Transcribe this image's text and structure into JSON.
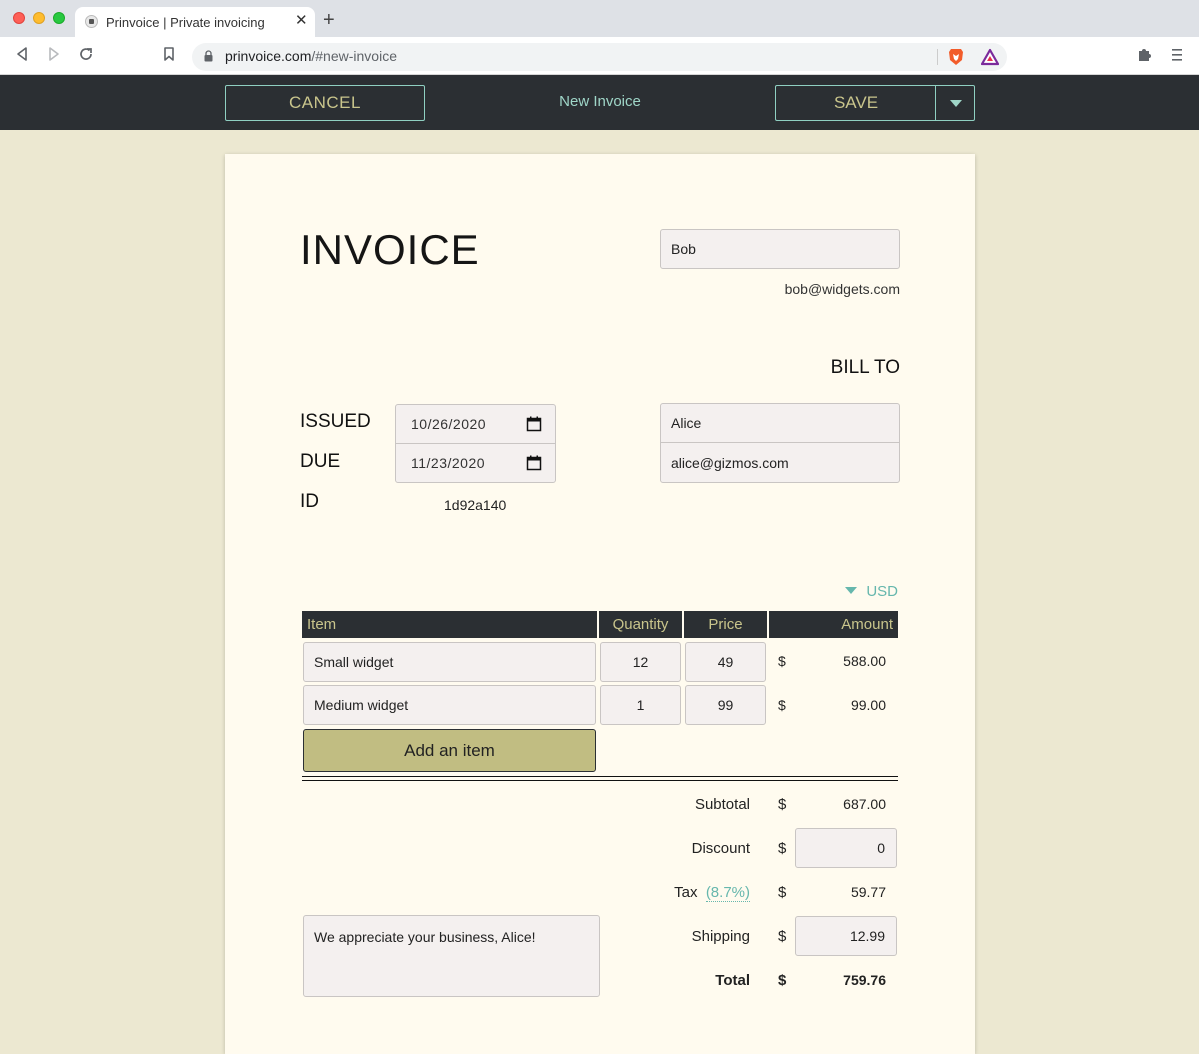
{
  "browser": {
    "tab_title": "Prinvoice | Private invoicing",
    "url_host": "prinvoice.com",
    "url_path": "/#new-invoice"
  },
  "header": {
    "cancel_label": "CANCEL",
    "title": "New Invoice",
    "save_label": "SAVE"
  },
  "invoice": {
    "heading": "INVOICE",
    "sender": {
      "name": "Bob",
      "email": "bob@widgets.com"
    },
    "bill_to_label": "BILL TO",
    "client": {
      "name": "Alice",
      "email": "alice@gizmos.com"
    },
    "issued_label": "ISSUED",
    "issued_date": "10/26/2020",
    "due_label": "DUE",
    "due_date": "11/23/2020",
    "id_label": "ID",
    "id_value": "1d92a140",
    "currency": "USD",
    "columns": [
      "Item",
      "Quantity",
      "Price",
      "Amount"
    ],
    "items": [
      {
        "name": "Small widget",
        "quantity": "12",
        "price": "49",
        "currency_symbol": "$",
        "amount": "588.00"
      },
      {
        "name": "Medium widget",
        "quantity": "1",
        "price": "99",
        "currency_symbol": "$",
        "amount": "99.00"
      }
    ],
    "add_item_label": "Add an item",
    "totals": {
      "currency_symbol": "$",
      "subtotal_label": "Subtotal",
      "subtotal": "687.00",
      "discount_label": "Discount",
      "discount": "0",
      "tax_label": "Tax",
      "tax_rate": "(8.7%)",
      "tax": "59.77",
      "shipping_label": "Shipping",
      "shipping": "12.99",
      "total_label": "Total",
      "total": "759.76"
    },
    "note": "We appreciate your business, Alice!"
  },
  "colors": {
    "header_bg": "#2b2f33",
    "accent_teal": "#66b7ad",
    "accent_olive": "#c1bd82",
    "page_bg": "#ece8d1",
    "paper_bg": "#fffbef"
  }
}
